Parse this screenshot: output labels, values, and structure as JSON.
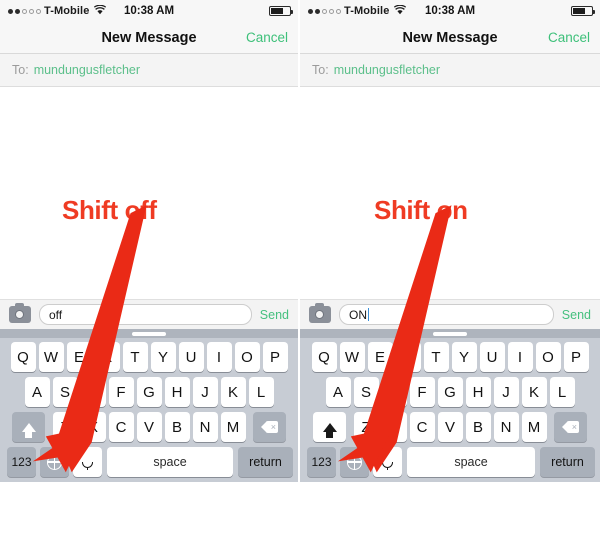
{
  "panels": [
    {
      "id": "left",
      "status": {
        "carrier": "T-Mobile",
        "time": "10:38 AM",
        "signal_filled": 2,
        "signal_total": 5,
        "battery_pct": 68
      },
      "nav": {
        "title": "New Message",
        "cancel_label": "Cancel"
      },
      "recipient": {
        "label": "To:",
        "value": "mundungusfletcher"
      },
      "annotation": {
        "text": "Shift off",
        "color": "#ef3b23"
      },
      "compose": {
        "value": "off",
        "placeholder": "",
        "send_label": "Send",
        "camera_icon": "camera-icon",
        "show_caret": false
      },
      "keyboard": {
        "row1": [
          "Q",
          "W",
          "E",
          "R",
          "T",
          "Y",
          "U",
          "I",
          "O",
          "P"
        ],
        "row2": [
          "A",
          "S",
          "D",
          "F",
          "G",
          "H",
          "J",
          "K",
          "L"
        ],
        "row3": [
          "Z",
          "X",
          "C",
          "V",
          "B",
          "N",
          "M"
        ],
        "shift_icon": "shift-arrow-icon",
        "shift_state": "off",
        "delete_icon": "backspace-icon",
        "numbers_label": "123",
        "globe_icon": "globe-icon",
        "mic_icon": "microphone-icon",
        "space_label": "space",
        "return_label": "return"
      }
    },
    {
      "id": "right",
      "status": {
        "carrier": "T-Mobile",
        "time": "10:38 AM",
        "signal_filled": 2,
        "signal_total": 5,
        "battery_pct": 68
      },
      "nav": {
        "title": "New Message",
        "cancel_label": "Cancel"
      },
      "recipient": {
        "label": "To:",
        "value": "mundungusfletcher"
      },
      "annotation": {
        "text": "Shift on",
        "color": "#ef3b23"
      },
      "compose": {
        "value": "ON",
        "placeholder": "",
        "send_label": "Send",
        "camera_icon": "camera-icon",
        "show_caret": true
      },
      "keyboard": {
        "row1": [
          "Q",
          "W",
          "E",
          "R",
          "T",
          "Y",
          "U",
          "I",
          "O",
          "P"
        ],
        "row2": [
          "A",
          "S",
          "D",
          "F",
          "G",
          "H",
          "J",
          "K",
          "L"
        ],
        "row3": [
          "Z",
          "X",
          "C",
          "V",
          "B",
          "N",
          "M"
        ],
        "shift_icon": "shift-arrow-icon",
        "shift_state": "on",
        "delete_icon": "backspace-icon",
        "numbers_label": "123",
        "globe_icon": "globe-icon",
        "mic_icon": "microphone-icon",
        "space_label": "space",
        "return_label": "return"
      }
    }
  ],
  "colors": {
    "accent_green": "#46c07f",
    "annotation_red": "#ef3b23",
    "keyboard_bg": "#c7ccd4",
    "key_gray": "#a9b0ba"
  }
}
